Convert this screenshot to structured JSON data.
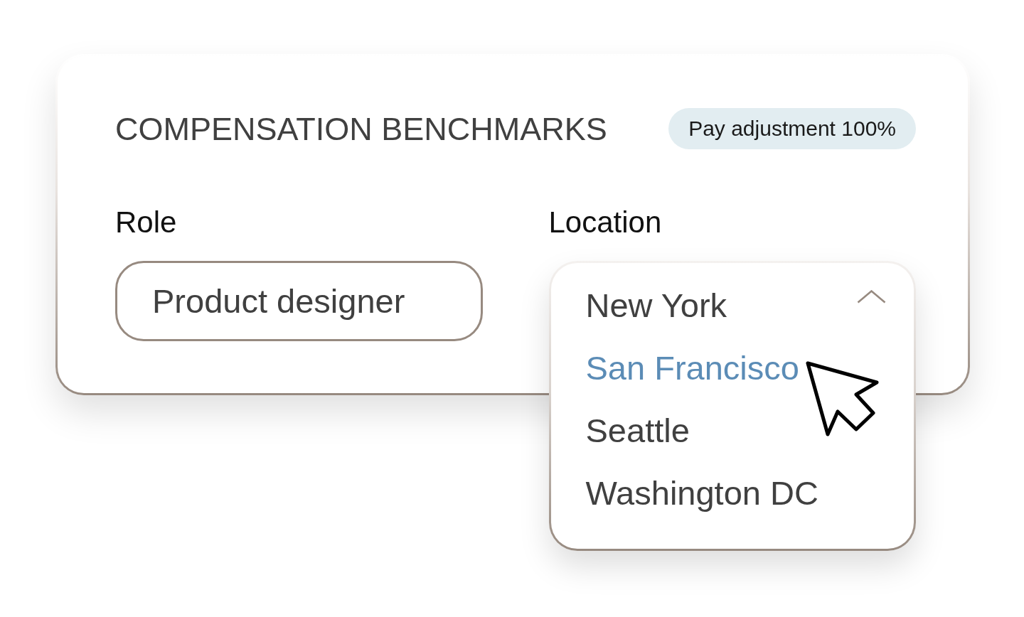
{
  "card": {
    "title": "COMPENSATION BENCHMARKS",
    "badge": "Pay adjustment 100%"
  },
  "fields": [
    {
      "kind": "text",
      "label": "Role",
      "value": "Product designer"
    },
    {
      "kind": "select",
      "label": "Location",
      "value": "New York",
      "expanded": true,
      "options": [
        {
          "label": "San Francisco",
          "highlighted": true
        },
        {
          "label": "Seattle",
          "highlighted": false
        },
        {
          "label": "Washington DC",
          "highlighted": false
        }
      ]
    }
  ]
}
